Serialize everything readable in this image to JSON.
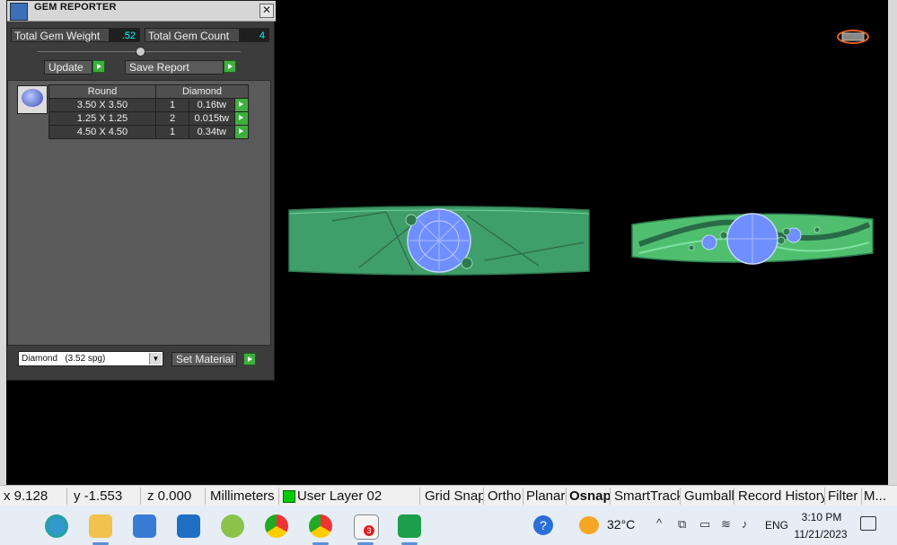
{
  "panel": {
    "title": "GEM REPORTER",
    "close_glyph": "✕",
    "total_weight_label": "Total Gem Weight",
    "total_weight_value": ".52",
    "total_count_label": "Total Gem Count",
    "total_count_value": "4",
    "update_label": "Update",
    "save_report_label": "Save Report",
    "table_headers": [
      "Round",
      "Diamond"
    ],
    "rows": [
      {
        "size": "3.50 X 3.50",
        "qty": "1",
        "weight": "0.16tw"
      },
      {
        "size": "1.25 X 1.25",
        "qty": "2",
        "weight": "0.015tw"
      },
      {
        "size": "4.50 X 4.50",
        "qty": "1",
        "weight": "0.34tw"
      }
    ],
    "material_value": "Diamond   (3.52 spg)",
    "set_material_label": "Set Material"
  },
  "statusbar": {
    "x": "x 9.128",
    "y": "y -1.553",
    "z": "z 0.000",
    "units": "Millimeters",
    "layer": "User Layer 02",
    "items": [
      "Grid Snap",
      "Ortho",
      "Planar",
      "Osnap",
      "SmartTrack",
      "Gumball",
      "Record History",
      "Filter",
      "M..."
    ]
  },
  "taskbar": {
    "weather": "32°C",
    "lang": "ENG",
    "time": "3:10 PM",
    "date": "11/21/2023",
    "badge": "3"
  },
  "colors": {
    "ring": "#3f9e6a",
    "gem": "#6f8fff",
    "accent_green": "#3fae3f"
  }
}
